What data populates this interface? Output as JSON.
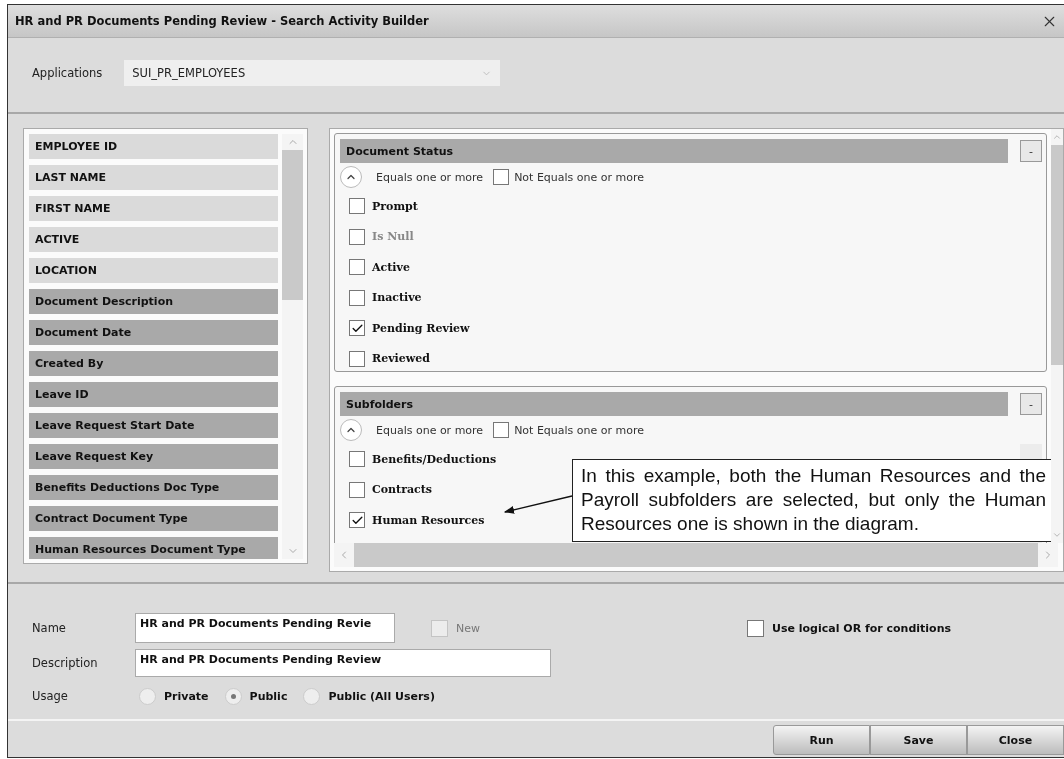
{
  "window": {
    "title": "HR and PR Documents Pending Review - Search Activity Builder"
  },
  "applications": {
    "label": "Applications",
    "value": "SUI_PR_EMPLOYEES"
  },
  "fields": [
    {
      "label": "EMPLOYEE ID",
      "kind": "key"
    },
    {
      "label": "LAST NAME",
      "kind": "key"
    },
    {
      "label": "FIRST NAME",
      "kind": "key"
    },
    {
      "label": "ACTIVE",
      "kind": "key"
    },
    {
      "label": "LOCATION",
      "kind": "key"
    },
    {
      "label": "Document Description",
      "kind": "attribute"
    },
    {
      "label": "Document Date",
      "kind": "attribute"
    },
    {
      "label": "Created By",
      "kind": "attribute"
    },
    {
      "label": "Leave ID",
      "kind": "attribute"
    },
    {
      "label": "Leave Request Start Date",
      "kind": "attribute"
    },
    {
      "label": "Leave Request Key",
      "kind": "attribute"
    },
    {
      "label": "Benefits Deductions Doc Type",
      "kind": "attribute"
    },
    {
      "label": "Contract Document Type",
      "kind": "attribute"
    },
    {
      "label": "Human Resources Document Type",
      "kind": "attribute"
    }
  ],
  "conditions": [
    {
      "title": "Document Status",
      "collapse": "-",
      "equals_label": "Equals one or more",
      "not_equals_label": "Not Equals one or more",
      "not_equals": false,
      "options": [
        {
          "label": "Prompt",
          "checked": false,
          "disabled": false
        },
        {
          "label": "Is Null",
          "checked": false,
          "disabled": true
        },
        {
          "label": "Active",
          "checked": false,
          "disabled": false
        },
        {
          "label": "Inactive",
          "checked": false,
          "disabled": false
        },
        {
          "label": "Pending Review",
          "checked": true,
          "disabled": false
        },
        {
          "label": "Reviewed",
          "checked": false,
          "disabled": false
        }
      ]
    },
    {
      "title": "Subfolders",
      "collapse": "-",
      "equals_label": "Equals one or more",
      "not_equals_label": "Not Equals one or more",
      "not_equals": false,
      "options": [
        {
          "label": "Benefits/Deductions",
          "checked": false,
          "disabled": false
        },
        {
          "label": "Contracts",
          "checked": false,
          "disabled": false
        },
        {
          "label": "Human Resources",
          "checked": true,
          "disabled": false
        }
      ]
    }
  ],
  "callout": {
    "text": "In this example, both the Human Resources and the Payroll subfolders are selected, but only the Human Resources one is shown in the diagram."
  },
  "form": {
    "name_label": "Name",
    "name_value": "HR and PR Documents Pending Revie",
    "new_label": "New",
    "new_checked": false,
    "description_label": "Description",
    "description_value": "HR and PR Documents Pending Review",
    "usage_label": "Usage",
    "usage": [
      {
        "label": "Private",
        "selected": false
      },
      {
        "label": "Public",
        "selected": true
      },
      {
        "label": "Public (All Users)",
        "selected": false
      }
    ],
    "logical_or_label": "Use logical OR for conditions",
    "logical_or": false
  },
  "buttons": [
    "Run",
    "Save",
    "Close"
  ]
}
